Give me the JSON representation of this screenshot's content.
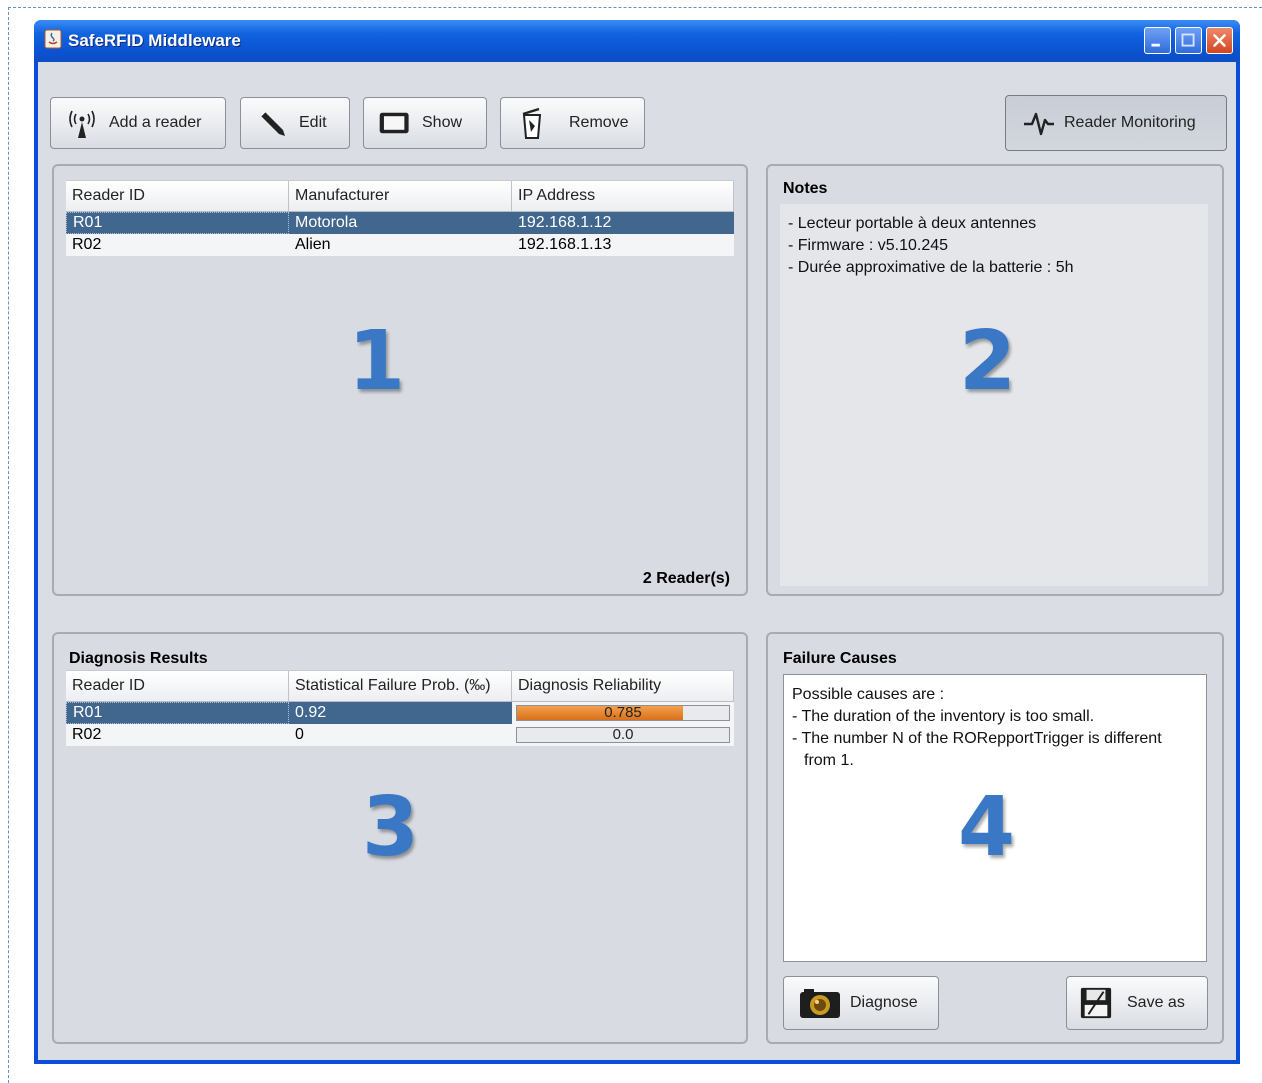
{
  "window": {
    "title": "SafeRFID Middleware"
  },
  "toolbar": {
    "add_reader": "Add a reader",
    "edit": "Edit",
    "show": "Show",
    "remove": "Remove",
    "reader_monitoring": "Reader Monitoring"
  },
  "readers_panel": {
    "columns": [
      "Reader ID",
      "Manufacturer",
      "IP Address"
    ],
    "rows": [
      {
        "id": "R01",
        "manufacturer": "Motorola",
        "ip": "192.168.1.12",
        "selected": true
      },
      {
        "id": "R02",
        "manufacturer": "Alien",
        "ip": "192.168.1.13",
        "selected": false
      }
    ],
    "count_label": "2 Reader(s)",
    "marker": "1"
  },
  "notes_panel": {
    "title": "Notes",
    "lines": [
      "- Lecteur portable à deux antennes",
      "- Firmware : v5.10.245",
      "- Durée approximative de la batterie : 5h"
    ],
    "marker": "2"
  },
  "diagnosis_panel": {
    "title": "Diagnosis Results",
    "columns": [
      "Reader ID",
      "Statistical Failure Prob. (‰)",
      "Diagnosis Reliability"
    ],
    "rows": [
      {
        "id": "R01",
        "prob": "0.92",
        "reliability": 0.785,
        "reliability_label": "0.785",
        "selected": true
      },
      {
        "id": "R02",
        "prob": "0",
        "reliability": 0.0,
        "reliability_label": "0.0",
        "selected": false
      }
    ],
    "marker": "3"
  },
  "failure_panel": {
    "title": "Failure Causes",
    "lines": [
      "Possible causes are :",
      "- The duration of the inventory is too small.",
      "- The number N of the RORepportTrigger is different",
      "  from 1."
    ],
    "diagnose": "Diagnose",
    "save_as": "Save as",
    "marker": "4"
  },
  "colors": {
    "selection": "#41678f",
    "progress": "#e08a30",
    "marker": "#3a78c5",
    "titlebar": "#0c54d2"
  },
  "icons": {
    "add_reader": "antenna-icon",
    "edit": "pencil-icon",
    "show": "monitor-icon",
    "remove": "trash-icon",
    "monitoring": "heartbeat-icon",
    "diagnose": "camera-icon",
    "save": "floppy-disk-icon"
  }
}
